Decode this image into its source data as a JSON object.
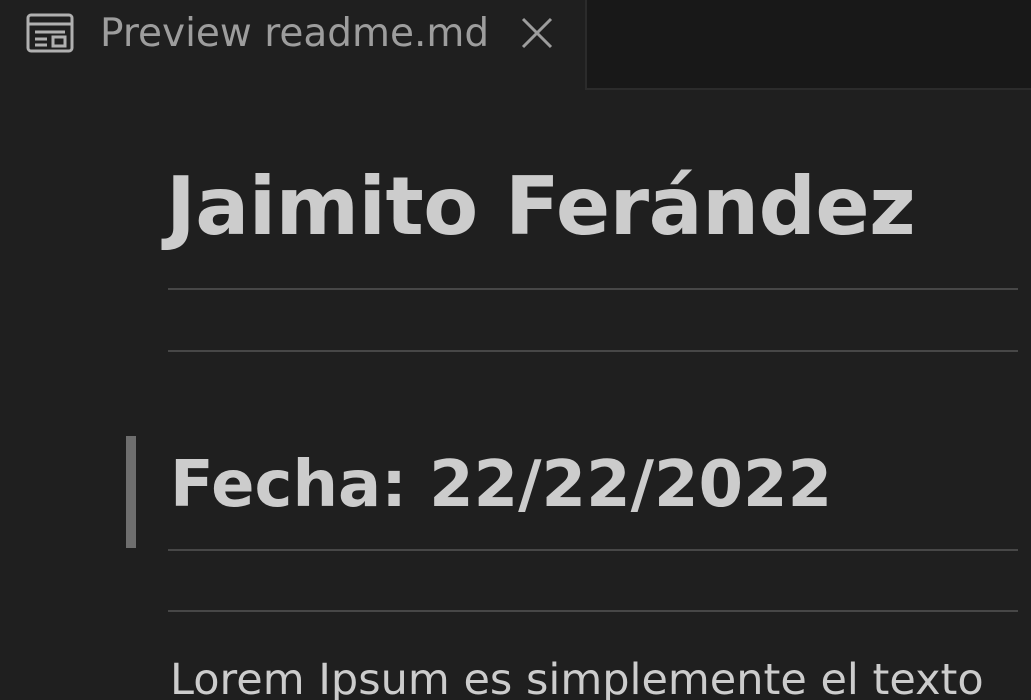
{
  "tab": {
    "icon": "preview-icon",
    "label": "Preview readme.md",
    "close_icon": "close-icon"
  },
  "document": {
    "heading": "Jaimito Ferández",
    "blockquote_heading": "Fecha: 22/22/2022",
    "paragraph": "Lorem Ipsum es simplemente el texto"
  },
  "colors": {
    "editor_background": "#1f1f1f",
    "tabbar_background": "#181818",
    "text": "#cccccc",
    "tab_label": "#9d9d9d",
    "rule": "#474747",
    "blockquote_bar": "#6e6e6e"
  }
}
